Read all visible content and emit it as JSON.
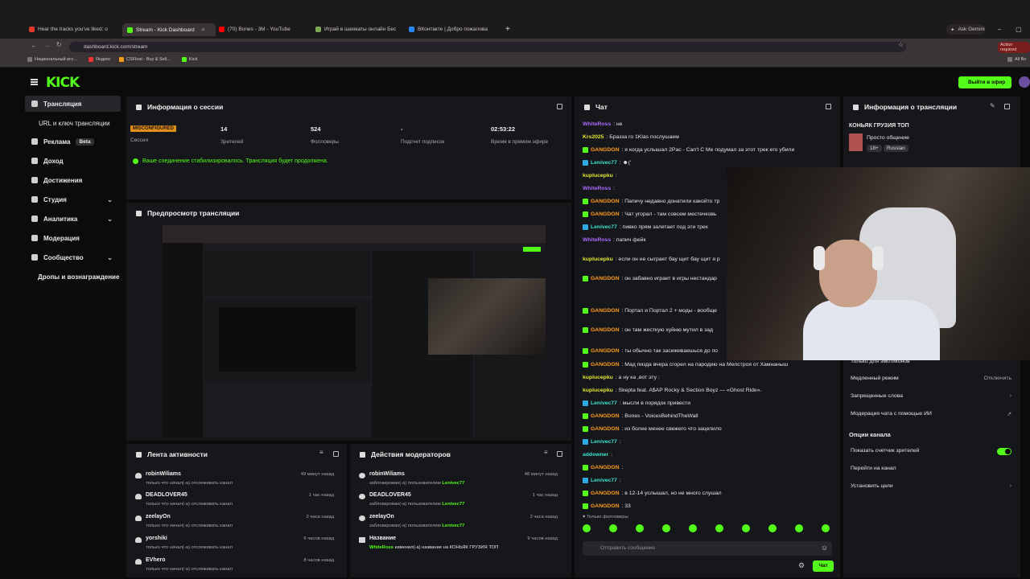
{
  "browser": {
    "tabs": [
      {
        "title": "Hear the tracks you've liked: o",
        "color": "#e2392c"
      },
      {
        "title": "Stream - Kick Dashboard",
        "color": "#53fc18"
      },
      {
        "title": "(70) Bones - 3M - YouTube",
        "color": "#ff0000"
      },
      {
        "title": "Играй в шахматы онлайн Бес",
        "color": "#7fa650"
      },
      {
        "title": "ВКонтакте | Добро пожалова",
        "color": "#2787f5"
      }
    ],
    "url": "dashboard.kick.com/stream",
    "bookmarks": [
      "Национальный исс...",
      "Яндекс",
      "CSFloat - Buy & Sell...",
      "Kick"
    ],
    "ask": "Ask Gemini",
    "action": "Action required",
    "all": "All Bo"
  },
  "header": {
    "logo": "KICK",
    "golive": "Выйти в эфир"
  },
  "sidebar": {
    "items": [
      {
        "label": "Трансляция",
        "active": true
      },
      {
        "label": "URL и ключ трансляции"
      },
      {
        "label": "Реклама",
        "badge": "Beta"
      },
      {
        "label": "Доход"
      },
      {
        "label": "Достижения"
      },
      {
        "label": "Студия"
      },
      {
        "label": "Аналитика"
      },
      {
        "label": "Модерация"
      },
      {
        "label": "Сообщество"
      },
      {
        "label": "Дропы и вознаграждение"
      }
    ]
  },
  "session": {
    "title": "Информация о сессии",
    "status": "MISCONFIGURED",
    "session_label": "Сессия",
    "viewers": "14",
    "viewers_label": "Зрителей",
    "followers": "524",
    "followers_label": "Фолловеры",
    "subs": "-",
    "subs_label": "Подсчет подписок",
    "time": "02:53:22",
    "time_label": "Время в прямом эфире",
    "message": "Ваше соединение стабилизировалось. Трансляция будет продолжена."
  },
  "preview": {
    "title": "Предпросмотр трансляции"
  },
  "activity": {
    "title": "Лента активности",
    "items": [
      {
        "name": "robinWiliams",
        "text": "только что начал(-а) отслеживать канал",
        "time": "49 минут назад"
      },
      {
        "name": "DEADLOVER45",
        "text": "только что начал(-а) отслеживать канал",
        "time": "1 час назад"
      },
      {
        "name": "zeelayOn",
        "text": "только что начал(-а) отслеживать канал",
        "time": "2 часа назад"
      },
      {
        "name": "yorshiki",
        "text": "только что начал(-а) отслеживать канал",
        "time": "6 часов назад"
      },
      {
        "name": "EVhero",
        "text": "только что начал(-а) отслеживать канал",
        "time": "8 часов назад"
      }
    ]
  },
  "modactions": {
    "title": "Действия модераторов",
    "items": [
      {
        "name": "robinWiliams",
        "text": "заблокирован(-а) пользователем",
        "who": "Lenivec77",
        "time": "48 минут назад"
      },
      {
        "name": "DEADLOVER45",
        "text": "заблокирован(-а) пользователем",
        "who": "Lenivec77",
        "time": "1 час назад"
      },
      {
        "name": "zeelayOn",
        "text": "заблокирован(-а) пользователем",
        "who": "Lenivec77",
        "time": "2 часа назад"
      },
      {
        "name": "Название",
        "text": "изменил(-а) название на КОНЬЯК ГРУЗИЯ ТОП",
        "who": "WhiteRoss",
        "time": "9 часов назад"
      }
    ]
  },
  "chat": {
    "title": "Чат",
    "lines": [
      {
        "user": "WhiteRoss",
        "cls": "u-p",
        "badge": "",
        "text": ": не"
      },
      {
        "user": "Krs2025",
        "cls": "u-y",
        "badge": "",
        "text": ": Бразза го 1Klas послушаем"
      },
      {
        "user": "GANGDON",
        "cls": "u-g",
        "badge": "g",
        "text": ": я когда услышал 2Pac - Can't C Me подумал за этот трек его убили"
      },
      {
        "user": "Lenivec77",
        "cls": "u-t",
        "badge": "b",
        "text": ": ☻(′"
      },
      {
        "user": "kuplucepku",
        "cls": "u-y",
        "badge": "",
        "text": ":"
      },
      {
        "user": "WhiteRoss",
        "cls": "u-p",
        "badge": "",
        "text": ":"
      },
      {
        "user": "GANGDON",
        "cls": "u-g",
        "badge": "g",
        "text": ": Папичу недавно донатили какойто тр"
      },
      {
        "user": "GANGDON",
        "cls": "u-g",
        "badge": "g",
        "text": ": Чат угорал - там совсем местечковь"
      },
      {
        "user": "Lenivec77",
        "cls": "u-t",
        "badge": "b",
        "text": ": пивко прям залетает под эти трек"
      },
      {
        "user": "WhiteRoss",
        "cls": "u-p",
        "badge": "",
        "text": ": папич фейк"
      },
      {
        "user": "kuplucepku",
        "cls": "u-y",
        "badge": "",
        "text": ": если он не сыграет бау щит бау щит я р"
      },
      {
        "user": "GANGDON",
        "cls": "u-g",
        "badge": "g",
        "text": ": он забавно играет в игры нестандар"
      },
      {
        "user": "GANGDON",
        "cls": "u-g",
        "badge": "g",
        "text": ": Портал и Портал 2 + моды - вообще"
      },
      {
        "user": "GANGDON",
        "cls": "u-g",
        "badge": "g",
        "text": ": он там жесткую хуйню мутил в зад"
      },
      {
        "user": "GANGDON",
        "cls": "u-g",
        "badge": "g",
        "text": ": ты обычно так засиживаешься до по"
      },
      {
        "user": "GANGDON",
        "cls": "u-g",
        "badge": "g",
        "text": ": Мад пизда вчера сгорел на пародию на Мелстроя от Хамнаныш"
      },
      {
        "user": "kuplucepku",
        "cls": "u-y",
        "badge": "",
        "text": ": а ну ка ,вот эту :"
      },
      {
        "user": "kuplucepku",
        "cls": "u-y",
        "badge": "",
        "text": ": Skepta feat. A$AP Rocky & Section Boyz — «Ghost Ride»."
      },
      {
        "user": "Lenivec77",
        "cls": "u-t",
        "badge": "b",
        "text": ": мысли в порядок привести"
      },
      {
        "user": "GANGDON",
        "cls": "u-g",
        "badge": "g",
        "text": ": Bones - VoicesBehindTheWall"
      },
      {
        "user": "GANGDON",
        "cls": "u-g",
        "badge": "g",
        "text": ": из более менее свежего что зацепило"
      },
      {
        "user": "Lenivec77",
        "cls": "u-t",
        "badge": "b",
        "text": ":"
      },
      {
        "user": "addowner",
        "cls": "u-t",
        "badge": "",
        "text": ":"
      },
      {
        "user": "GANGDON",
        "cls": "u-g",
        "badge": "g",
        "text": ":"
      },
      {
        "user": "Lenivec77",
        "cls": "u-t",
        "badge": "b",
        "text": ":"
      },
      {
        "user": "GANGDON",
        "cls": "u-g",
        "badge": "g",
        "text": ": в 12-14 услышал, но не много слушал"
      },
      {
        "user": "GANGDON",
        "cls": "u-g",
        "badge": "g",
        "text": ": 33"
      }
    ],
    "followers_only": "Только фолловеры",
    "placeholder": "Отправить сообщение",
    "send": "Чат"
  },
  "info": {
    "title": "Информация о трансляции",
    "stream_title": "КОНЬЯК ГРУЗИЯ ТОП",
    "category": "Просто общение",
    "tags": [
      "18+",
      "Russian"
    ],
    "rows": [
      {
        "label": "Только для эмотиконов",
        "right": ""
      },
      {
        "label": "Медленный режим",
        "right": "Отключить"
      },
      {
        "label": "Запрещенные слова",
        "right": "›"
      },
      {
        "label": "Модерация чата с помощью ИИ",
        "right": "↗"
      }
    ],
    "options_title": "Опции канала",
    "option_rows": [
      {
        "label": "Показать счетчик зрителей",
        "right": "toggle"
      },
      {
        "label": "Перейти на канал",
        "right": ""
      },
      {
        "label": "Установить цели",
        "right": "›"
      }
    ]
  }
}
